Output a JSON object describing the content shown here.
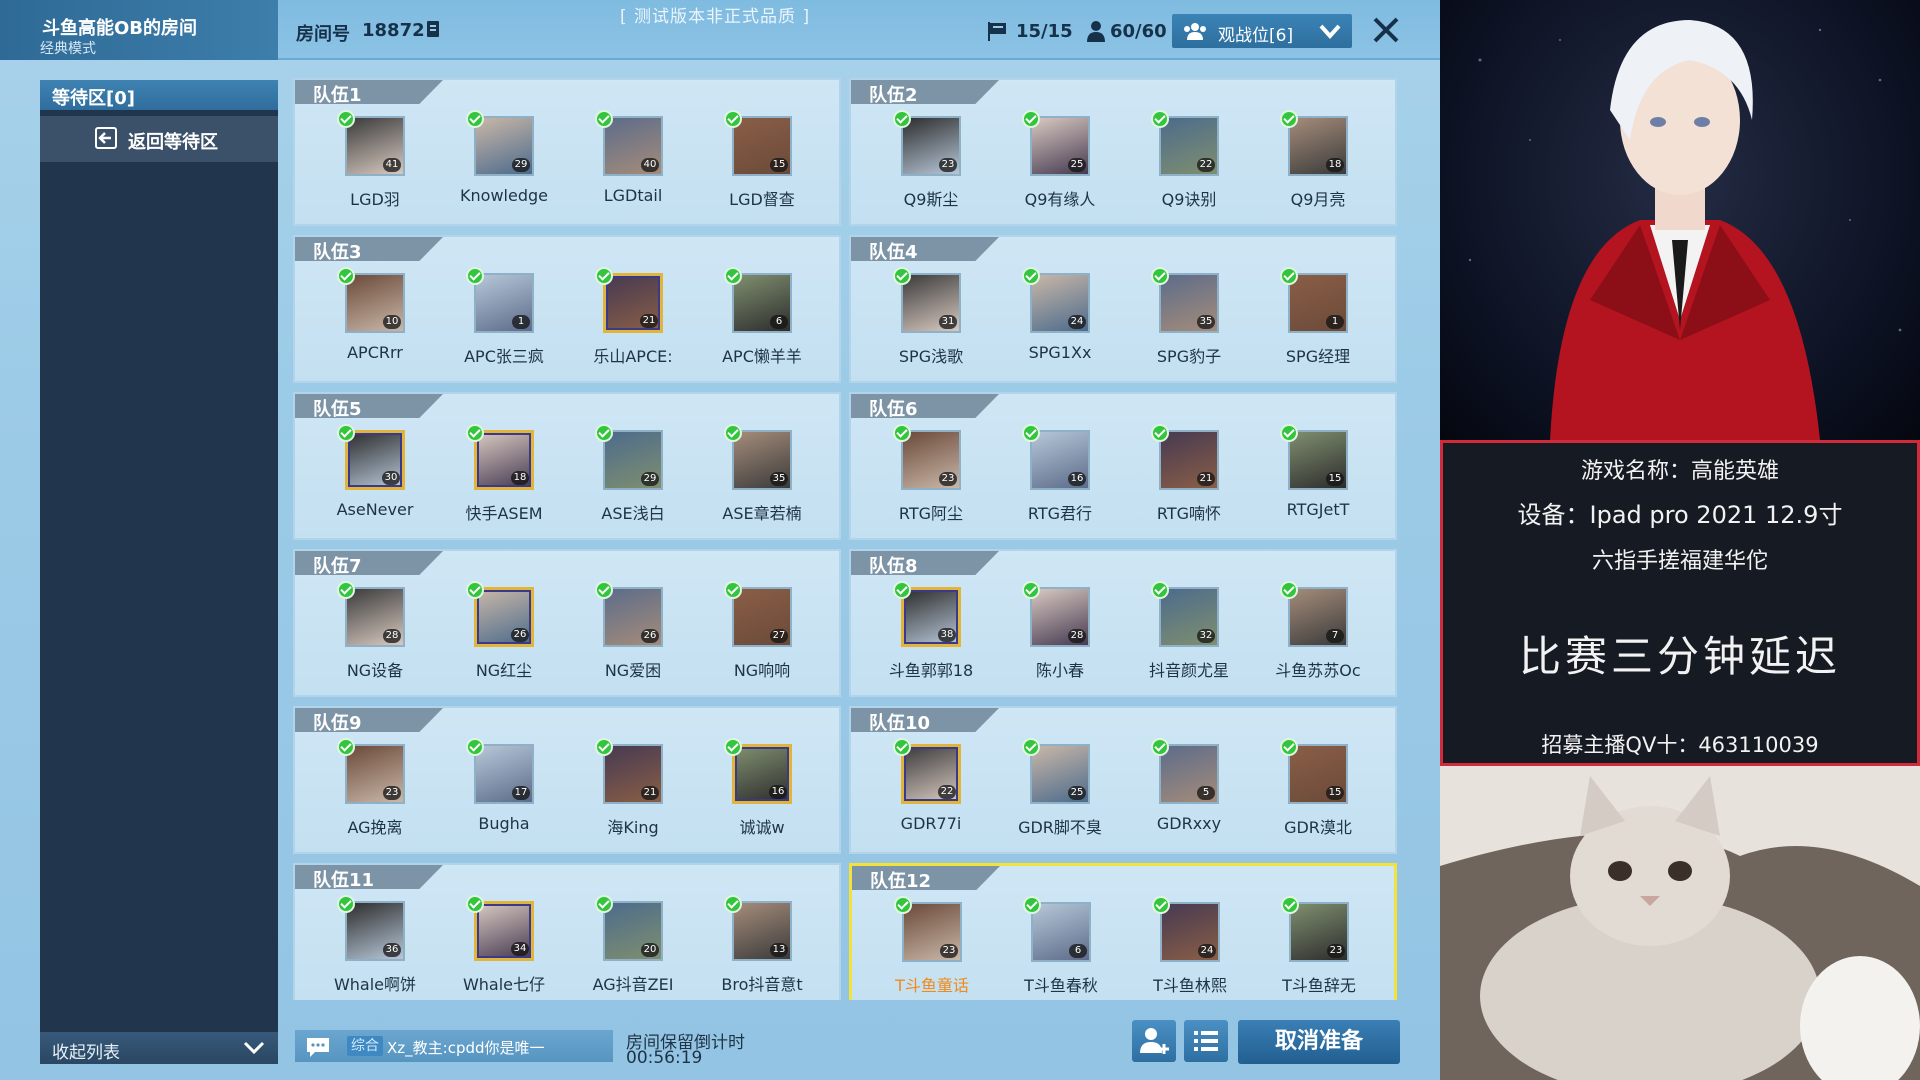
{
  "header": {
    "room_title": "斗鱼高能OB的房间",
    "room_mode": "经典模式",
    "room_number_label": "房间号",
    "room_number": "18872",
    "test_notice": "[ 测试版本非正式品质 ]",
    "teams_count": "15/15",
    "players_count": "60/60",
    "observer_label": "观战位[6]"
  },
  "sidebar": {
    "waiting_label": "等待区[0]",
    "return_label": "返回等待区",
    "collapse_label": "收起列表"
  },
  "teams": [
    {
      "name": "队伍1",
      "players": [
        {
          "name": "LGD羽",
          "level": "41"
        },
        {
          "name": "Knowledge",
          "level": "29"
        },
        {
          "name": "LGDtail",
          "level": "40"
        },
        {
          "name": "LGD督查",
          "level": "15"
        }
      ]
    },
    {
      "name": "队伍2",
      "players": [
        {
          "name": "Q9斯尘",
          "level": "23"
        },
        {
          "name": "Q9有缘人",
          "level": "25"
        },
        {
          "name": "Q9诀别",
          "level": "22"
        },
        {
          "name": "Q9月亮",
          "level": "18"
        }
      ]
    },
    {
      "name": "队伍3",
      "players": [
        {
          "name": "APCRrr",
          "level": "10"
        },
        {
          "name": "APC张三疯",
          "level": "1"
        },
        {
          "name": "乐山APCE:",
          "level": "21"
        },
        {
          "name": "APC懒羊羊",
          "level": "6"
        }
      ]
    },
    {
      "name": "队伍4",
      "players": [
        {
          "name": "SPG浅歌",
          "level": "31"
        },
        {
          "name": "SPG1Xx",
          "level": "24"
        },
        {
          "name": "SPG豹子",
          "level": "35"
        },
        {
          "name": "SPG经理",
          "level": "1"
        }
      ]
    },
    {
      "name": "队伍5",
      "players": [
        {
          "name": "AseNever",
          "level": "30"
        },
        {
          "name": "快手ASEM",
          "level": "18"
        },
        {
          "name": "ASE浅白",
          "level": "29"
        },
        {
          "name": "ASE章若楠",
          "level": "35"
        }
      ]
    },
    {
      "name": "队伍6",
      "players": [
        {
          "name": "RTG阿尘",
          "level": "23"
        },
        {
          "name": "RTG君行",
          "level": "16"
        },
        {
          "name": "RTG喃怀",
          "level": "21"
        },
        {
          "name": "RTGJetT",
          "level": "15"
        }
      ]
    },
    {
      "name": "队伍7",
      "players": [
        {
          "name": "NG设备",
          "level": "28"
        },
        {
          "name": "NG红尘",
          "level": "26"
        },
        {
          "name": "NG爱困",
          "level": "26"
        },
        {
          "name": "NG响响",
          "level": "27"
        }
      ]
    },
    {
      "name": "队伍8",
      "players": [
        {
          "name": "斗鱼郭郭18",
          "level": "38"
        },
        {
          "name": "陈小春",
          "level": "28"
        },
        {
          "name": "抖音颜尤星",
          "level": "32"
        },
        {
          "name": "斗鱼苏苏Oc",
          "level": "7"
        }
      ]
    },
    {
      "name": "队伍9",
      "players": [
        {
          "name": "AG挽离",
          "level": "23"
        },
        {
          "name": "Bugha",
          "level": "17"
        },
        {
          "name": "海King",
          "level": "21"
        },
        {
          "name": "诚诚w",
          "level": "16"
        }
      ]
    },
    {
      "name": "队伍10",
      "players": [
        {
          "name": "GDR77i",
          "level": "22"
        },
        {
          "name": "GDR脚不臭",
          "level": "25"
        },
        {
          "name": "GDRxxy",
          "level": "5"
        },
        {
          "name": "GDR漠北",
          "level": "15"
        }
      ]
    },
    {
      "name": "队伍11",
      "players": [
        {
          "name": "Whale啊饼",
          "level": "36"
        },
        {
          "name": "Whale七仔",
          "level": "34"
        },
        {
          "name": "AG抖音ZEI",
          "level": "20"
        },
        {
          "name": "Bro抖音意t",
          "level": "13"
        }
      ]
    },
    {
      "name": "队伍12",
      "players": [
        {
          "name": "T斗鱼童话",
          "level": "23"
        },
        {
          "name": "T斗鱼春秋",
          "level": "6"
        },
        {
          "name": "T斗鱼林熙",
          "level": "24"
        },
        {
          "name": "T斗鱼辞无",
          "level": "23"
        }
      ]
    }
  ],
  "bottom": {
    "chat_tag": "综合",
    "chat_text": "Xz_教主:cpdd你是唯一",
    "timer_label": "房间保留倒计时",
    "timer_value": "00:56:19",
    "cancel_ready_label": "取消准备"
  },
  "stream_info": {
    "game_name": "游戏名称：高能英雄",
    "device": "设备：Ipad pro 2021 12.9寸",
    "controls": "六指手搓福建华佗",
    "delay_notice": "比赛三分钟延迟",
    "recruit": "招募主播QV十：463110039"
  },
  "colors": {
    "accent": "#2f6d9c",
    "check_green": "#34c53e",
    "highlight_border": "#f2e23a",
    "stream_card_border": "#d12a3a"
  }
}
